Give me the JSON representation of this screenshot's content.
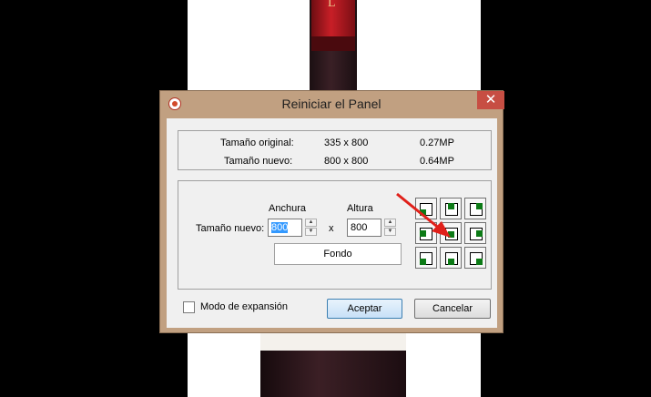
{
  "background": {
    "cap_letter": "L"
  },
  "dialog": {
    "title": "Reiniciar el Panel",
    "close_glyph": "✕",
    "info": {
      "original_label": "Tamaño original:",
      "original_dims": "335 x 800",
      "original_mp": "0.27MP",
      "new_label": "Tamaño nuevo:",
      "new_dims": "800 x 800",
      "new_mp": "0.64MP"
    },
    "resize": {
      "width_header": "Anchura",
      "height_header": "Altura",
      "new_size_label": "Tamaño nuevo:",
      "width_value": "800",
      "height_value": "800",
      "times": "x",
      "background_button": "Fondo",
      "spin_up": "▲",
      "spin_down": "▼"
    },
    "expand_mode_label": "Modo de expansión",
    "accept_label": "Aceptar",
    "cancel_label": "Cancelar"
  },
  "colors": {
    "accent_green": "#0c7a16",
    "arrow_red": "#e0201a",
    "close_red": "#c74e43"
  }
}
